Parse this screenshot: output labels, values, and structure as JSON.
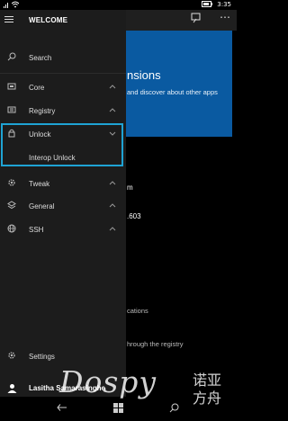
{
  "status_bar": {
    "signal_icon": "signal-icon",
    "time": "3:35"
  },
  "background_app": {
    "hero_title": "nsions",
    "hero_text": "and discover about other apps",
    "text_1": "m",
    "text_2": ".603",
    "text_3": "cations",
    "text_4": "hrough the registry"
  },
  "panel": {
    "title": "WELCOME",
    "search_label": "Search",
    "items": [
      {
        "label": "Core",
        "icon": "core-icon"
      },
      {
        "label": "Registry",
        "icon": "registry-icon"
      },
      {
        "label": "Unlock",
        "icon": "lock-icon"
      },
      {
        "label": "Interop Unlock"
      },
      {
        "label": "Tweak",
        "icon": "gear-icon"
      },
      {
        "label": "General",
        "icon": "layers-icon"
      },
      {
        "label": "SSH",
        "icon": "globe-icon"
      }
    ],
    "settings_label": "Settings",
    "user_name": "Lasitha Samarasinghe"
  },
  "watermark": {
    "text": "Dospy",
    "cn": "诺亚方舟"
  },
  "colors": {
    "panel_bg": "#1c1c1c",
    "accent_highlight": "#1fa3d4",
    "hero_bg": "#0a5aa1"
  }
}
